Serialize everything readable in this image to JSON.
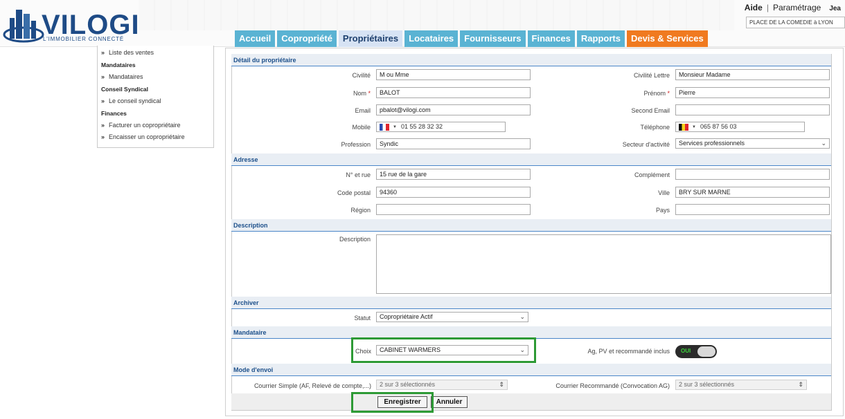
{
  "header": {
    "logo_text": "VILOGI",
    "logo_sub": "L'IMMOBILIER CONNECTÉ",
    "aide": "Aide",
    "parametrage": "Paramétrage",
    "user": "Jea",
    "residence": "PLACE DE LA COMEDIE à LYON",
    "separator": "|"
  },
  "tabs": [
    {
      "label": "Accueil"
    },
    {
      "label": "Copropriété"
    },
    {
      "label": "Propriétaires"
    },
    {
      "label": "Locataires"
    },
    {
      "label": "Fournisseurs"
    },
    {
      "label": "Finances"
    },
    {
      "label": "Rapports"
    },
    {
      "label": "Devis & Services"
    }
  ],
  "sidebar": {
    "arrow": "»",
    "item_ventes": "Liste des ventes",
    "head_mandataires": "Mandataires",
    "item_mandataires": "Mandataires",
    "head_conseil": "Conseil Syndical",
    "item_conseil": "Le conseil syndical",
    "head_finances": "Finances",
    "item_facturer": "Facturer un copropriétaire",
    "item_encaisser": "Encaisser un copropriétaire"
  },
  "form": {
    "sections": {
      "detail": "Détail du propriétaire",
      "adresse": "Adresse",
      "description": "Description",
      "archiver": "Archiver",
      "mandataire": "Mandataire",
      "envoi": "Mode d'envoi"
    },
    "required_mark": "*",
    "civilite": {
      "label": "Civilité",
      "value": "M ou Mme"
    },
    "civilite_lettre": {
      "label": "Civilité Lettre",
      "value": "Monsieur Madame"
    },
    "nom": {
      "label": "Nom",
      "value": "BALOT"
    },
    "prenom": {
      "label": "Prénom",
      "value": "Pierre"
    },
    "email": {
      "label": "Email",
      "value": "pbalot@vilogi.com"
    },
    "second_email": {
      "label": "Second Email",
      "value": ""
    },
    "mobile": {
      "label": "Mobile",
      "value": "01 55 28 32 32"
    },
    "telephone": {
      "label": "Téléphone",
      "value": "065 87 56 03"
    },
    "profession": {
      "label": "Profession",
      "value": "Syndic"
    },
    "secteur": {
      "label": "Secteur d'activité",
      "value": "Services professionnels"
    },
    "numero_rue": {
      "label": "N° et rue",
      "value": "15 rue de la gare"
    },
    "complement": {
      "label": "Complément",
      "value": ""
    },
    "code_postal": {
      "label": "Code postal",
      "value": "94360"
    },
    "ville": {
      "label": "Ville",
      "value": "BRY SUR MARNE"
    },
    "region": {
      "label": "Région",
      "value": ""
    },
    "pays": {
      "label": "Pays",
      "value": ""
    },
    "description_label": "Description",
    "statut": {
      "label": "Statut",
      "value": "Copropriétaire Actif"
    },
    "choix": {
      "label": "Choix",
      "value": "CABINET WARMERS"
    },
    "ag_label": "Ag, PV et recommandé inclus",
    "toggle_text": "OUI",
    "courrier_simple": {
      "label": "Courrier Simple (AF, Relevé de compte,...)",
      "value": "2 sur 3 sélectionnés"
    },
    "courrier_recommande": {
      "label": "Courrier Recommandé (Convocation AG)",
      "value": "2 sur 3 sélectionnés"
    },
    "save_label": "Enregistrer",
    "cancel_label": "Annuler"
  },
  "colors": {
    "tab": "#5ab3d3",
    "tab_active": "#d7e3f4",
    "tab_orange": "#f07a20",
    "section_text": "#1c4f8a",
    "highlight": "#2d9a35"
  }
}
